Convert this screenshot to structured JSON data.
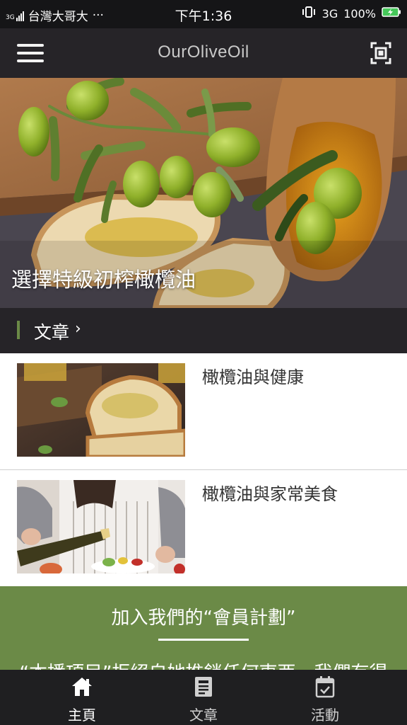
{
  "status_bar": {
    "signal": "3G",
    "carrier": "台灣大哥大",
    "more": "···",
    "time": "下午1:36",
    "network": "3G",
    "battery": "100%"
  },
  "app_bar": {
    "title": "OurOliveOil",
    "menu_icon": "hamburger-menu-icon",
    "scan_icon": "scan-icon"
  },
  "hero": {
    "caption": "選擇特級初榨橄欖油"
  },
  "articles_section": {
    "title": "文章",
    "chevron": "›"
  },
  "articles": [
    {
      "title": "橄欖油與健康"
    },
    {
      "title": "橄欖油與家常美食"
    }
  ],
  "member": {
    "title": "加入我們的“會員計劃”",
    "body": "“本播項目”拒絕自她推銷任何東西，我們有得"
  },
  "tab_bar": {
    "tabs": [
      {
        "label": "主頁",
        "icon": "home-icon",
        "active": true
      },
      {
        "label": "文章",
        "icon": "article-icon",
        "active": false
      },
      {
        "label": "活動",
        "icon": "calendar-check-icon",
        "active": false
      }
    ]
  },
  "colors": {
    "accent_green": "#6b8a47",
    "bar_dark": "#262428"
  }
}
